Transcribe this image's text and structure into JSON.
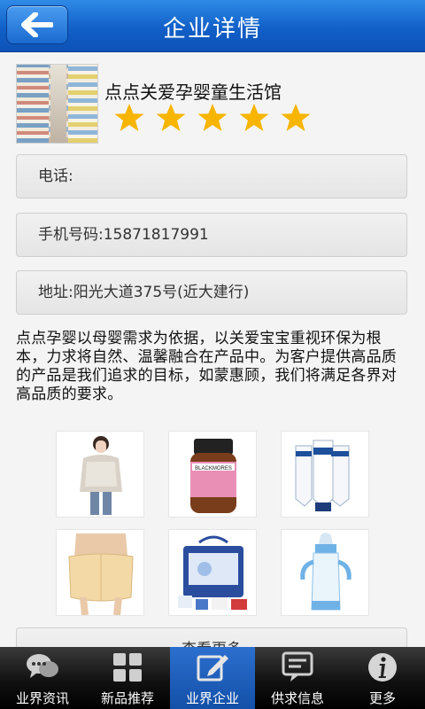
{
  "header": {
    "title": "企业详情",
    "back_icon": "arrow-left-icon"
  },
  "company": {
    "name": "点点关爱孕婴童生活馆",
    "rating": 5,
    "rating_max": 5
  },
  "info": {
    "phone": "电话:",
    "mobile": "手机号码:15871817991",
    "address": "地址:阳光大道375号(近大建行)"
  },
  "description": "点点孕婴以母婴需求为依据，以关爱宝宝重视环保为根本，力求将自然、温馨融合在产品中。为客户提供高品质的产品是我们追求的目标，如蒙惠顾，我们将满足各界对高品质的要求。",
  "products": [
    {
      "name": "maternity-top"
    },
    {
      "name": "supplement-bottle"
    },
    {
      "name": "cream-tubes"
    },
    {
      "name": "belly-band"
    },
    {
      "name": "baby-gift-set"
    },
    {
      "name": "feeding-bottle"
    }
  ],
  "more_label": "查看更多",
  "tabs": [
    {
      "label": "业界资讯",
      "icon": "chat-bubbles-icon",
      "active": false
    },
    {
      "label": "新品推荐",
      "icon": "grid-icon",
      "active": false
    },
    {
      "label": "业界企业",
      "icon": "edit-icon",
      "active": true
    },
    {
      "label": "供求信息",
      "icon": "message-icon",
      "active": false
    },
    {
      "label": "更多",
      "icon": "info-icon",
      "active": false
    }
  ],
  "colors": {
    "header": "#1160c8",
    "star": "#f7b500",
    "tab_active": "#2c6fce"
  }
}
